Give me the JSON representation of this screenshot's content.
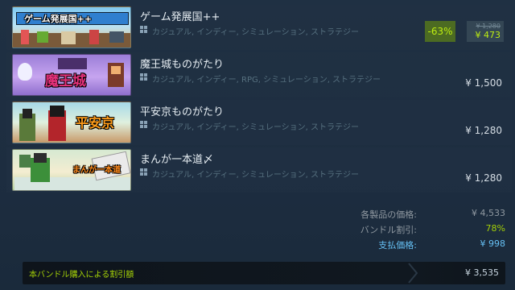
{
  "games": [
    {
      "title": "ゲーム発展国++",
      "tags": "カジュアル, インディー, シミュレーション, ストラテジー",
      "logo": "ゲーム発展国++",
      "discount": {
        "percent": "-63%",
        "original": "¥ 1,280",
        "final": "¥ 473"
      }
    },
    {
      "title": "魔王城ものがたり",
      "tags": "カジュアル, インディー, RPG, シミュレーション, ストラテジー",
      "logo": "魔王城",
      "price": "¥ 1,500"
    },
    {
      "title": "平安京ものがたり",
      "tags": "カジュアル, インディー, シミュレーション, ストラテジー",
      "logo": "平安京",
      "price": "¥ 1,280"
    },
    {
      "title": "まんが一本道〆",
      "tags": "カジュアル, インディー, シミュレーション, ストラテジー",
      "logo": "まんが一本道",
      "price": "¥ 1,280"
    }
  ],
  "summary": {
    "items_price_label": "各製品の価格:",
    "items_price_value": "¥ 4,533",
    "bundle_discount_label": "バンドル割引:",
    "bundle_discount_value": "78%",
    "pay_price_label": "支払価格:",
    "pay_price_value": "¥ 998"
  },
  "savings": {
    "label": "本バンドル購入による割引額",
    "value": "¥ 3,535"
  },
  "colors": {
    "background": "#1b2838",
    "discount_green": "#beee11",
    "discount_bg": "#4c6b22",
    "link_blue": "#66c0f4"
  },
  "icons": {
    "platform": "windows-icon",
    "chevron": "chevron-right-icon"
  }
}
